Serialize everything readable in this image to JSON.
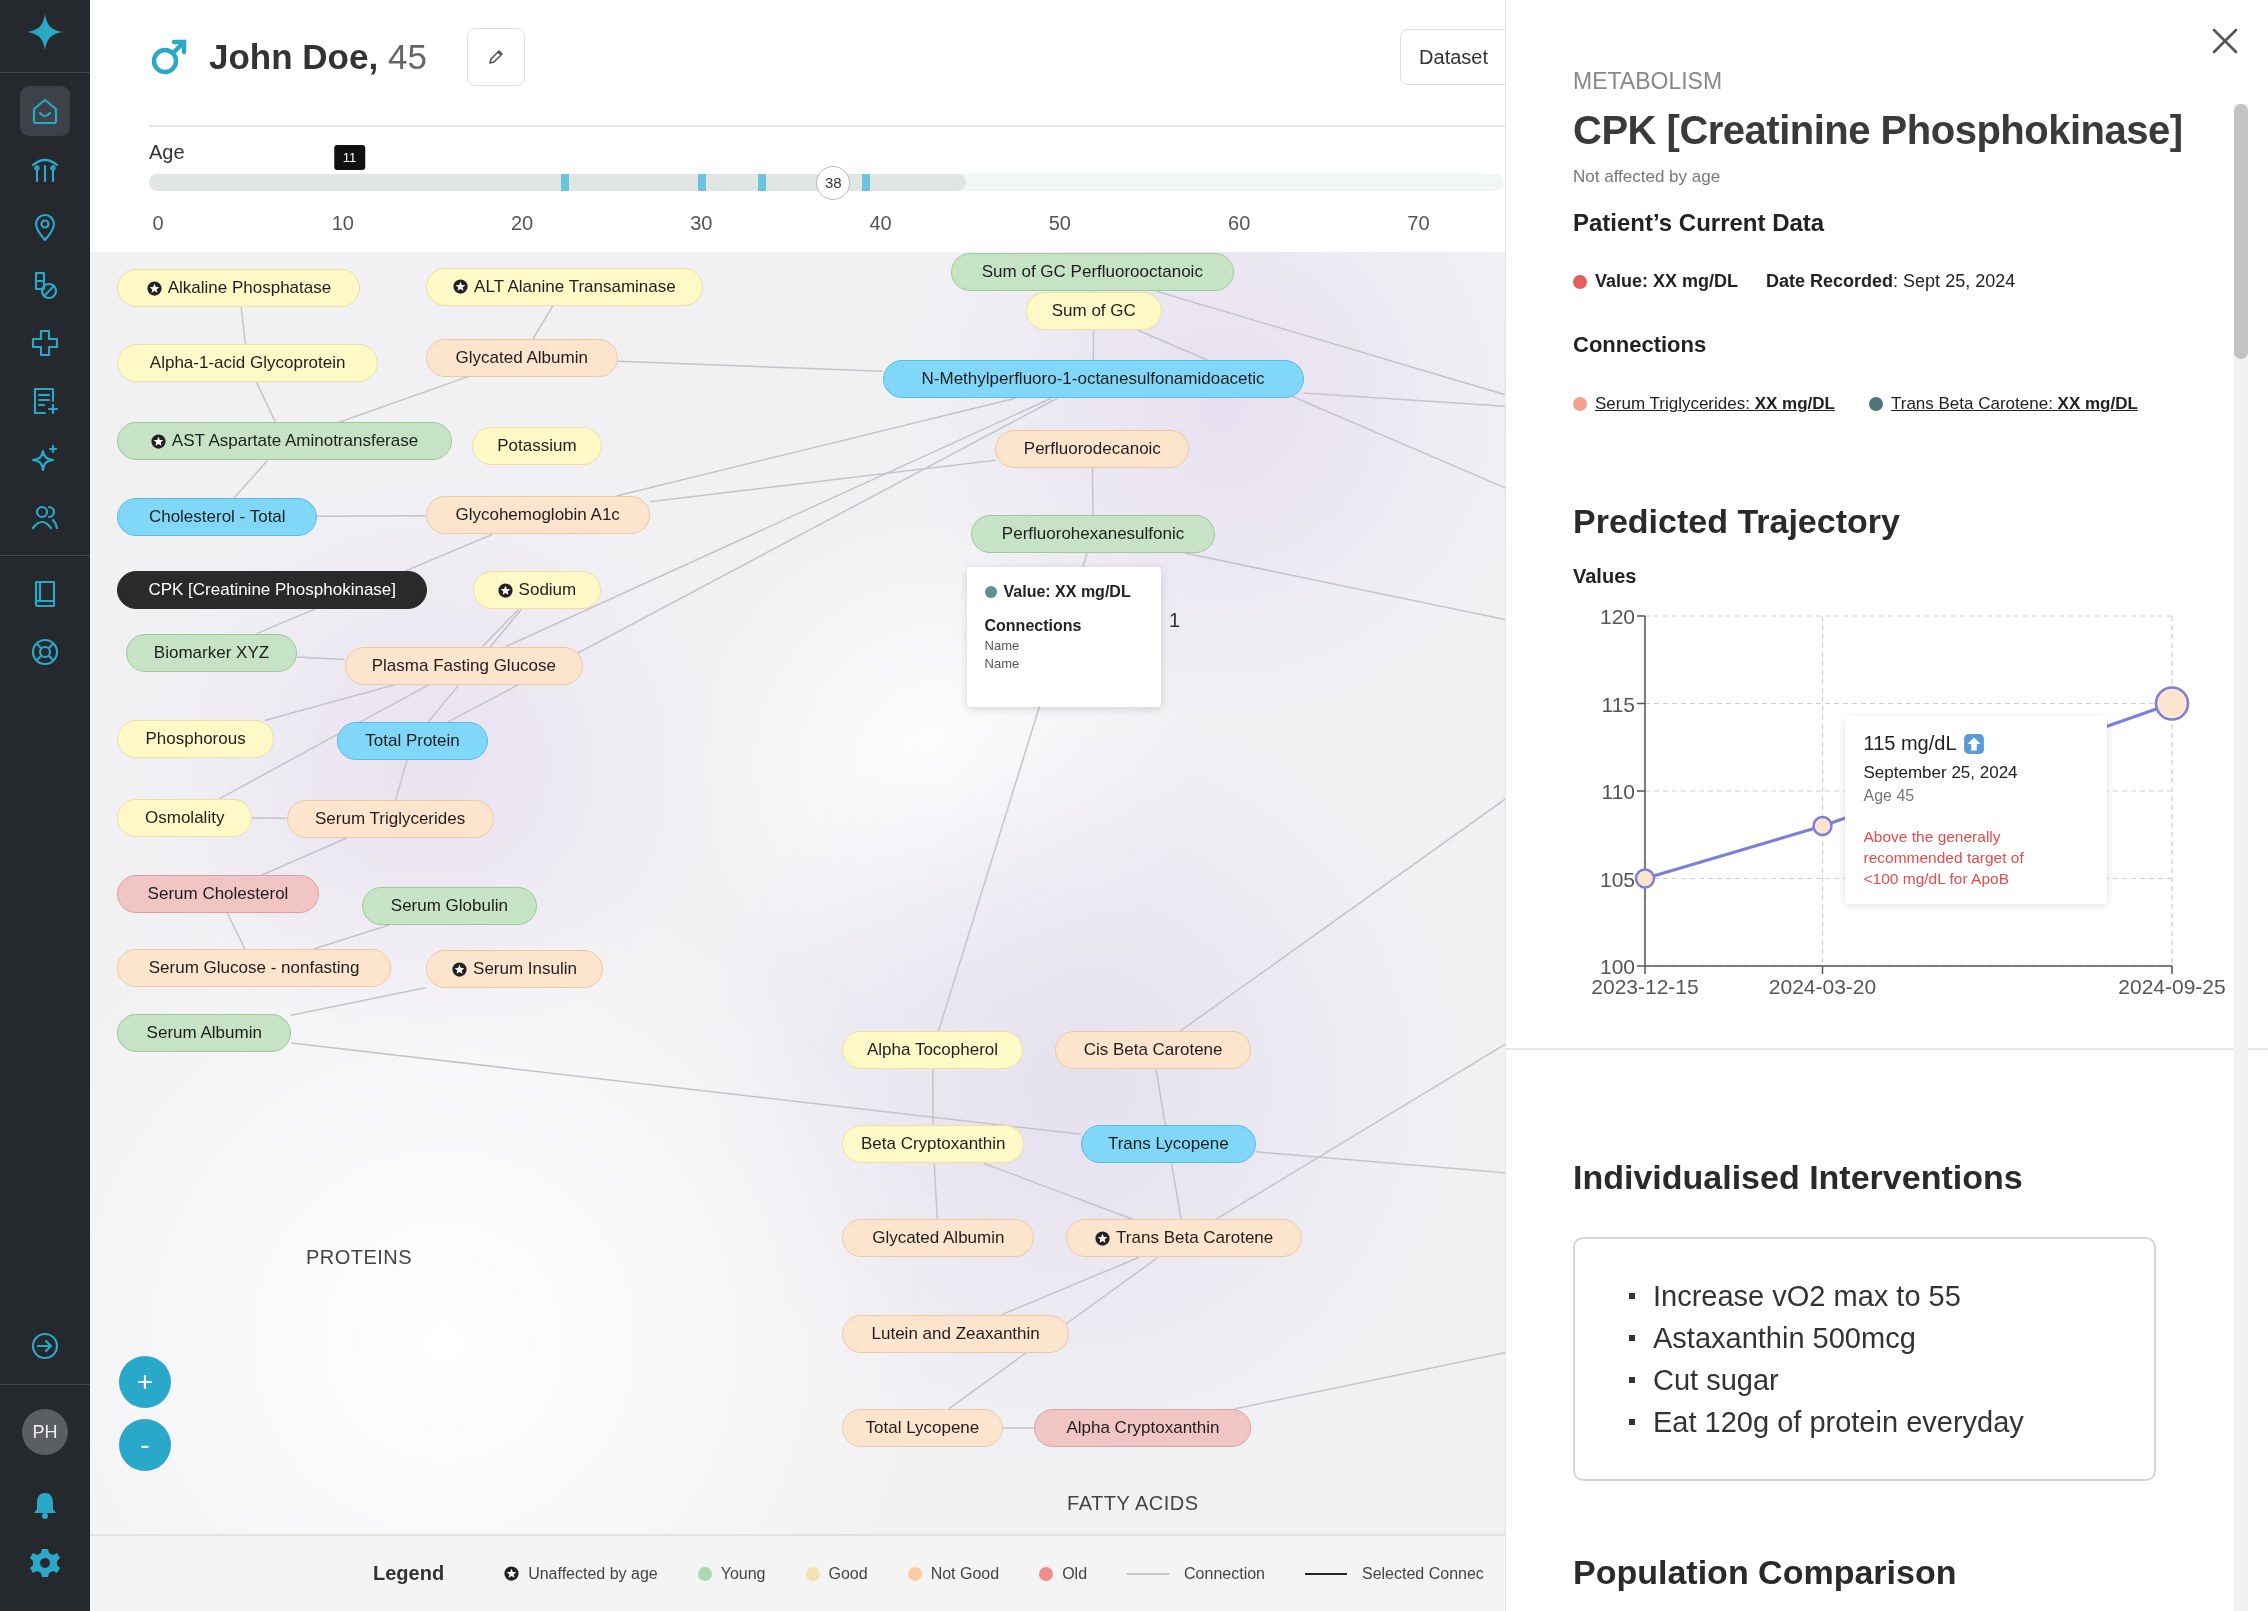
{
  "sidebar": {
    "items": [
      {
        "kind": "home",
        "selected": true
      },
      {
        "kind": "chart",
        "selected": false
      },
      {
        "kind": "location",
        "selected": false
      },
      {
        "kind": "pills",
        "selected": false
      },
      {
        "kind": "medical",
        "selected": false
      },
      {
        "kind": "report",
        "selected": false
      },
      {
        "kind": "sparkle",
        "selected": false
      },
      {
        "kind": "people",
        "selected": false
      }
    ],
    "resources": [
      {
        "kind": "book",
        "selected": false
      },
      {
        "kind": "support",
        "selected": false
      }
    ],
    "logout": {
      "kind": "logout"
    },
    "avatar": "PH",
    "bottom": [
      {
        "kind": "bell"
      },
      {
        "kind": "settings"
      }
    ]
  },
  "patient": {
    "name": "John Doe,",
    "age": "45"
  },
  "dataset_button": "Dataset",
  "age_slider": {
    "label": "Age",
    "value": "38",
    "level": 0.505,
    "range": {
      "level": 0.603
    },
    "markers": [
      {
        "level": 0.307
      },
      {
        "level": 0.408
      },
      {
        "level": 0.4525
      },
      {
        "level": 0.529
      }
    ],
    "pin": {
      "label": "11"
    },
    "ticks": [
      "0",
      "10",
      "20",
      "30",
      "40",
      "50",
      "60",
      "70"
    ]
  },
  "graph": {
    "nodes": [
      {
        "label": "Alkaline Phosphatase",
        "kind": "good",
        "unaffected": true,
        "selected": false
      },
      {
        "label": "ALT Alanine Transaminase",
        "kind": "good",
        "unaffected": true,
        "selected": false
      },
      {
        "label": "Alpha-1-acid Glycoprotein",
        "kind": "good",
        "unaffected": false,
        "selected": false
      },
      {
        "label": "Glycated Albumin",
        "kind": "not_good",
        "unaffected": false,
        "selected": false
      },
      {
        "label": "Sum of GC Perfluorooctanoic",
        "kind": "young",
        "unaffected": false,
        "selected": false
      },
      {
        "label": "Sum of GC",
        "kind": "good",
        "unaffected": false,
        "selected": false
      },
      {
        "label": "N-Methylperfluoro-1-octanesulfonamidoacetic",
        "kind": "highlighted",
        "unaffected": false,
        "selected": false
      },
      {
        "label": "AST Aspartate Aminotransferase",
        "kind": "young",
        "unaffected": true,
        "selected": false
      },
      {
        "label": "Potassium",
        "kind": "good",
        "unaffected": false,
        "selected": false
      },
      {
        "label": "Perfluorodecanoic",
        "kind": "not_good",
        "unaffected": false,
        "selected": false
      },
      {
        "label": "Cholesterol - Total",
        "kind": "highlighted",
        "unaffected": false,
        "selected": false
      },
      {
        "label": "Glycohemoglobin A1c",
        "kind": "not_good",
        "unaffected": false,
        "selected": false
      },
      {
        "label": "Perfluorohexanesulfonic",
        "kind": "young",
        "unaffected": false,
        "selected": false
      },
      {
        "label": "CPK [Creatinine Phosphokinase]",
        "kind": "young",
        "unaffected": false,
        "selected": true
      },
      {
        "label": "Sodium",
        "kind": "good",
        "unaffected": true,
        "selected": false
      },
      {
        "label": "Biomarker XYZ",
        "kind": "young",
        "unaffected": false,
        "selected": false
      },
      {
        "label": "Plasma Fasting Glucose",
        "kind": "not_good",
        "unaffected": false,
        "selected": false
      },
      {
        "label": "Phosphorous",
        "kind": "good",
        "unaffected": false,
        "selected": false
      },
      {
        "label": "Total Protein",
        "kind": "highlighted",
        "unaffected": false,
        "selected": false
      },
      {
        "label": "Osmolality",
        "kind": "good",
        "unaffected": false,
        "selected": false
      },
      {
        "label": "Serum Triglycerides",
        "kind": "not_good",
        "unaffected": false,
        "selected": false
      },
      {
        "label": "Serum Cholesterol",
        "kind": "old",
        "unaffected": false,
        "selected": false
      },
      {
        "label": "Serum Globulin",
        "kind": "young",
        "unaffected": false,
        "selected": false
      },
      {
        "label": "Serum Glucose - nonfasting",
        "kind": "not_good",
        "unaffected": false,
        "selected": false
      },
      {
        "label": "Serum Insulin",
        "kind": "not_good",
        "unaffected": true,
        "selected": false
      },
      {
        "label": "Serum Albumin",
        "kind": "young",
        "unaffected": false,
        "selected": false
      },
      {
        "label": "Alpha Tocopherol",
        "kind": "good",
        "unaffected": false,
        "selected": false
      },
      {
        "label": "Cis Beta Carotene",
        "kind": "not_good",
        "unaffected": false,
        "selected": false
      },
      {
        "label": "Beta Cryptoxanthin",
        "kind": "good",
        "unaffected": false,
        "selected": false
      },
      {
        "label": "Trans Lycopene",
        "kind": "highlighted",
        "unaffected": false,
        "selected": false
      },
      {
        "label": "Glycated Albumin",
        "kind": "not_good",
        "unaffected": false,
        "selected": false
      },
      {
        "label": "Trans Beta Carotene",
        "kind": "not_good",
        "unaffected": true,
        "selected": false
      },
      {
        "label": "Lutein and Zeaxanthin",
        "kind": "not_good",
        "unaffected": false,
        "selected": false
      },
      {
        "label": "Total Lycopene",
        "kind": "not_good",
        "unaffected": false,
        "selected": false
      },
      {
        "label": "Alpha Cryptoxanthin",
        "kind": "old",
        "unaffected": false,
        "selected": false
      }
    ],
    "tooltip": {
      "value": "Value: XX mg/DL",
      "color": "#5f8f8f",
      "title": "Connections",
      "names": [
        "Name",
        "Name"
      ]
    },
    "fragment": "1",
    "clusters": [
      "PROTEINS",
      "FATTY ACIDS"
    ],
    "zoom_in": "+",
    "zoom_out": "-"
  },
  "legend": {
    "title": "Legend",
    "items": [
      {
        "kind": "unaffected",
        "label": "Unaffected by age"
      },
      {
        "kind": "dot",
        "label": "Young",
        "color": "#a9d8b2"
      },
      {
        "kind": "dot",
        "label": "Good",
        "color": "#f3e2b6"
      },
      {
        "kind": "dot",
        "label": "Not Good",
        "color": "#f8cda4"
      },
      {
        "kind": "dot",
        "label": "Old",
        "color": "#f08c8c"
      },
      {
        "kind": "line",
        "label": "Connection",
        "color": "#c4c4c8"
      },
      {
        "kind": "line",
        "label": "Selected Connec",
        "color": "#222222"
      }
    ]
  },
  "panel": {
    "category": "METABOLISM",
    "title": "CPK [Creatinine Phosphokinase]",
    "subtitle": "Not affected by age",
    "current_heading": "Patient’s Current  Data",
    "current": {
      "value": "Value: XX mg/DL",
      "color": "#e85c5c",
      "date": "**Date Recorded**: Sept 25, 2024"
    },
    "connections_heading": "Connections",
    "connections": [
      {
        "text": "Serum Triglycerides: **XX mg/DL**",
        "color": "#f4a08c"
      },
      {
        "text": "Trans Beta Carotene: **XX mg/DL**",
        "color": "#4f7676"
      }
    ],
    "trajectory_heading": "Predicted Trajectory",
    "chart_data": {
      "type": "line",
      "ylabel": "Values",
      "x": [
        "2023-12-15",
        "2024-03-20",
        "2024-09-25"
      ],
      "series": [
        {
          "color": "#7b7fdc",
          "marker": "circle",
          "values": [
            105,
            108,
            115
          ]
        }
      ],
      "xlim": [
        "2023-12-15",
        "2024-09-25"
      ],
      "ylim": [
        100,
        120
      ],
      "yticks": [
        100,
        105,
        110,
        115,
        120
      ],
      "xticks": [
        "2023-12-15",
        "2024-03-20",
        "2024-09-25"
      ],
      "grid": true
    },
    "chart_tooltip": {
      "value": "115 mg/dL",
      "date": "September 25, 2024",
      "age": "Age 45",
      "note": "Above the generally recommended target of <100 mg/dL for ApoB"
    },
    "interventions_heading": "Individualised Interventions",
    "interventions": [
      "Increase vO2 max to 55",
      "Astaxanthin  500mcg",
      "Cut sugar",
      "Eat 120g of protein everyday"
    ],
    "population_heading": "Population Comparison"
  }
}
